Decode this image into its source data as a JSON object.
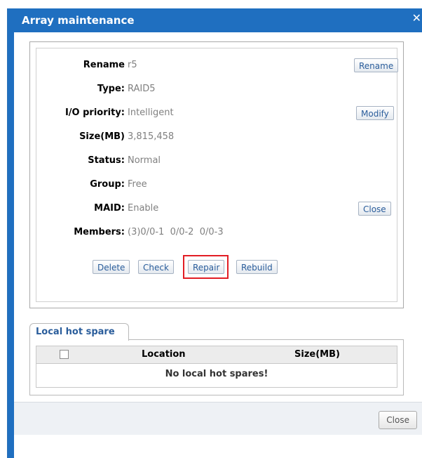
{
  "dialog": {
    "title": "Array maintenance"
  },
  "fields": {
    "rename_label": "Rename",
    "rename_value": "r5",
    "type_label": "Type:",
    "type_value": "RAID5",
    "io_label": "I/O priority:",
    "io_value": "Intelligent",
    "size_label": "Size(MB)",
    "size_value": "3,815,458",
    "status_label": "Status:",
    "status_value": "Normal",
    "group_label": "Group:",
    "group_value": "Free",
    "maid_label": "MAID:",
    "maid_value": "Enable",
    "members_label": "Members:",
    "members_value": "(3)0/0-1  0/0-2  0/0-3"
  },
  "side_buttons": {
    "rename": "Rename",
    "modify": "Modify",
    "close": "Close"
  },
  "actions": {
    "delete": "Delete",
    "check": "Check",
    "repair": "Repair",
    "rebuild": "Rebuild"
  },
  "highlight_color": "#e21d24",
  "hot_spare": {
    "tab_label": "Local hot spare",
    "columns": [
      "Location",
      "Size(MB)"
    ],
    "empty_message": "No local hot spares!"
  },
  "footer": {
    "close_label": "Close"
  }
}
